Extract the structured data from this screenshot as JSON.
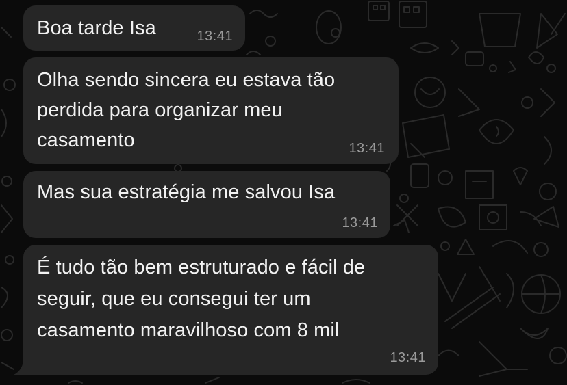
{
  "chat": {
    "messages": [
      {
        "lines": [
          "Boa tarde Isa"
        ],
        "time": "13:41"
      },
      {
        "lines": [
          "Olha sendo sincera eu estava tão",
          "perdida para organizar meu",
          "casamento"
        ],
        "time": "13:41"
      },
      {
        "lines": [
          "Mas sua estratégia me salvou Isa"
        ],
        "time": "13:41"
      },
      {
        "lines": [
          "É tudo tão bem estruturado e fácil de",
          "seguir, que eu consegui ter um",
          "casamento maravilhoso com 8 mil"
        ],
        "time": "13:41"
      }
    ]
  },
  "colors": {
    "background": "#0b0b0b",
    "bubble": "#262626",
    "text": "#f2f2f2",
    "timestamp": "#9a9a9a"
  }
}
